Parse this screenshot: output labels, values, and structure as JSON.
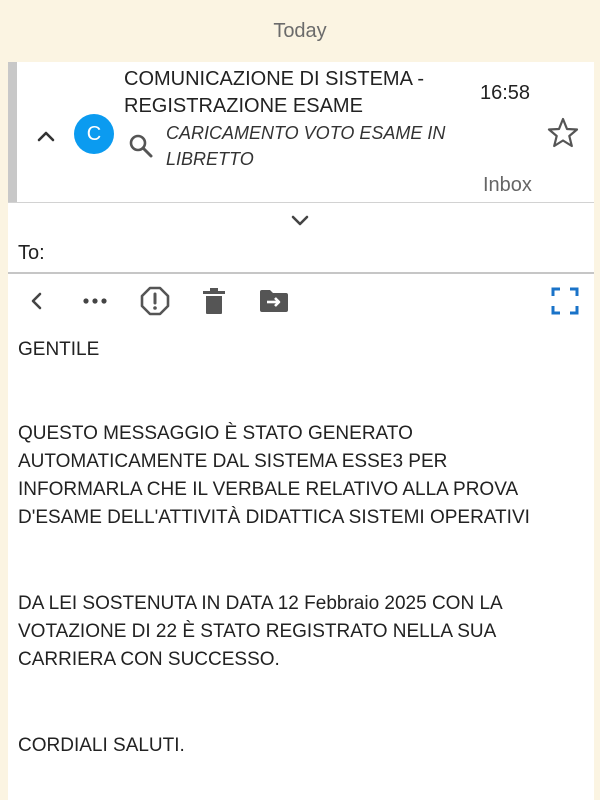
{
  "list": {
    "date_header": "Today"
  },
  "message": {
    "avatar_letter": "C",
    "subject_line1": "COMUNICAZIONE DI SISTEMA -",
    "subject_line2": "REGISTRAZIONE ESAME",
    "time": "16:58",
    "preview_line1": "CARICAMENTO VOTO ESAME IN",
    "preview_line2": "LIBRETTO",
    "folder": "Inbox",
    "to_label": "To:"
  },
  "toolbar": {
    "icons": [
      "back-icon",
      "more-icon",
      "report-spam-icon",
      "delete-icon",
      "move-to-folder-icon",
      "fullscreen-icon"
    ]
  },
  "body": {
    "greeting": "GENTILE",
    "p1_line1": "QUESTO MESSAGGIO È STATO GENERATO",
    "p1_line2": "AUTOMATICAMENTE DAL SISTEMA ESSE3 PER",
    "p1_line3": "INFORMARLA CHE IL VERBALE RELATIVO ALLA PROVA",
    "p1_line4": "D'ESAME DELL'ATTIVITÀ DIDATTICA SISTEMI OPERATIVI",
    "p2_line1": "DA LEI SOSTENUTA IN DATA 12 Febbraio 2025 CON LA",
    "p2_line2": "VOTAZIONE DI  22 È STATO REGISTRATO NELLA SUA",
    "p2_line3": "CARRIERA CON SUCCESSO.",
    "closing": "CORDIALI SALUTI."
  },
  "colors": {
    "background": "#fbf4e2",
    "avatar": "#0b9bf0",
    "fullscreen_icon": "#1a73c8",
    "icon_gray": "#555555"
  }
}
